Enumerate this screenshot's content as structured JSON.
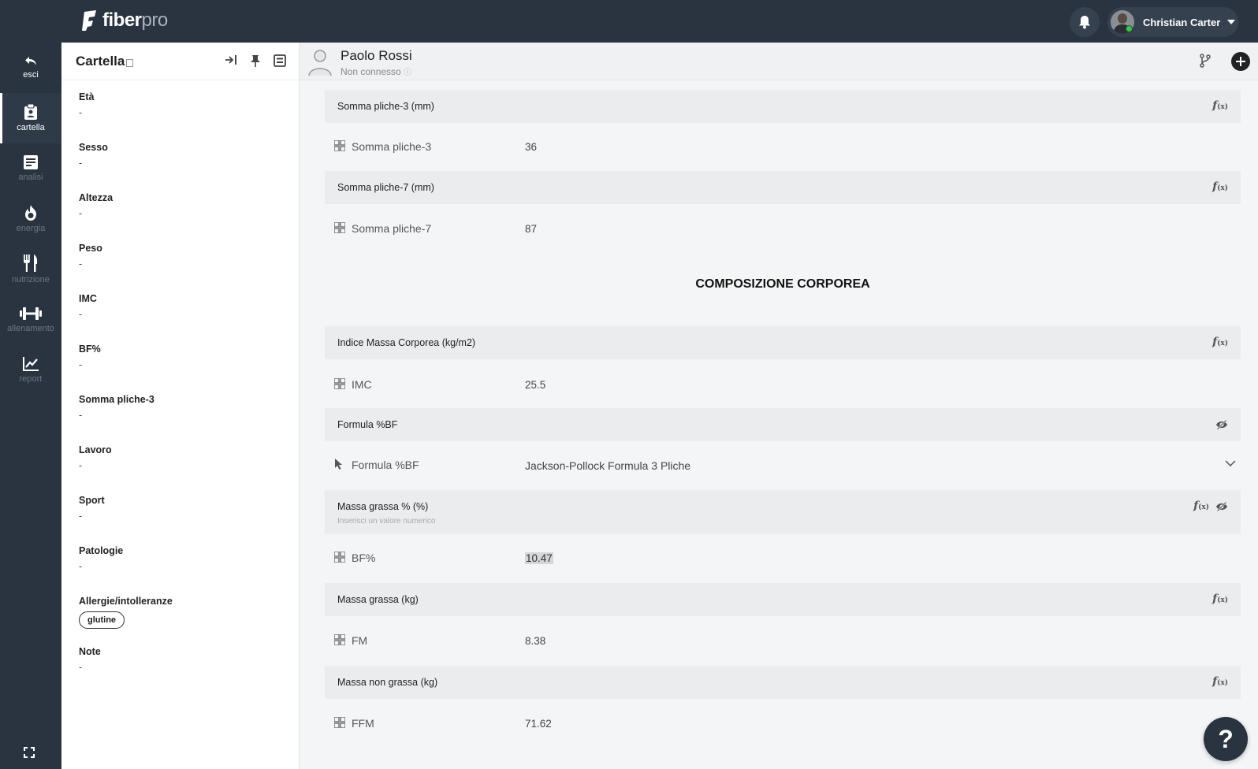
{
  "app": {
    "brand_main": "fiber",
    "brand_suffix": "pro"
  },
  "user": {
    "name": "Christian Carter"
  },
  "nav": {
    "items": [
      {
        "id": "esci",
        "label": "esci",
        "icon": "back-arrow-icon"
      },
      {
        "id": "cartella",
        "label": "cartella",
        "icon": "clipboard-icon",
        "active": true
      },
      {
        "id": "analisi",
        "label": "analisi",
        "icon": "document-icon"
      },
      {
        "id": "energia",
        "label": "energia",
        "icon": "flame-icon"
      },
      {
        "id": "nutrizione",
        "label": "nutrizione",
        "icon": "fork-knife-icon"
      },
      {
        "id": "allenamento",
        "label": "allenamento",
        "icon": "dumbbell-icon"
      },
      {
        "id": "report",
        "label": "report",
        "icon": "chart-line-icon"
      }
    ]
  },
  "sidepanel": {
    "title": "Cartella",
    "fields": [
      {
        "key": "Età",
        "value": "-"
      },
      {
        "key": "Sesso",
        "value": "-"
      },
      {
        "key": "Altezza",
        "value": "-"
      },
      {
        "key": "Peso",
        "value": "-"
      },
      {
        "key": "IMC",
        "value": "-"
      },
      {
        "key": "BF%",
        "value": "-"
      },
      {
        "key": "Somma pliche-3",
        "value": "-"
      },
      {
        "key": "Lavoro",
        "value": "-"
      },
      {
        "key": "Sport",
        "value": "-"
      },
      {
        "key": "Patologie",
        "value": "-"
      },
      {
        "key": "Allergie/intolleranze",
        "tag": "glutine"
      },
      {
        "key": "Note",
        "value": "-"
      }
    ]
  },
  "patient": {
    "name": "Paolo Rossi",
    "status": "Non connesso"
  },
  "main": {
    "section_title": "COMPOSIZIONE CORPOREA",
    "blocks": [
      {
        "header": "Somma pliche-3 (mm)",
        "label": "Somma pliche-3",
        "value": "36"
      },
      {
        "header": "Somma pliche-7 (mm)",
        "label": "Somma pliche-7",
        "value": "87"
      },
      {
        "header": "Indice Massa Corporea (kg/m2)",
        "label": "IMC",
        "value": "25.5"
      },
      {
        "header": "Formula %BF",
        "label": "Formula %BF",
        "value": "Jackson-Pollock Formula 3 Pliche"
      },
      {
        "header": "Massa grassa % (%)",
        "hint": "Inserisci un valore numerico",
        "label": "BF%",
        "value": "10.47"
      },
      {
        "header": "Massa grassa (kg)",
        "label": "FM",
        "value": "8.38"
      },
      {
        "header": "Massa non grassa (kg)",
        "label": "FFM",
        "value": "71.62"
      }
    ]
  },
  "help": {
    "label": "?"
  },
  "colors": {
    "sidebar": "#2a3441",
    "panel": "#ffffff",
    "section_bg": "#ebecee",
    "online": "#2ecc40"
  }
}
